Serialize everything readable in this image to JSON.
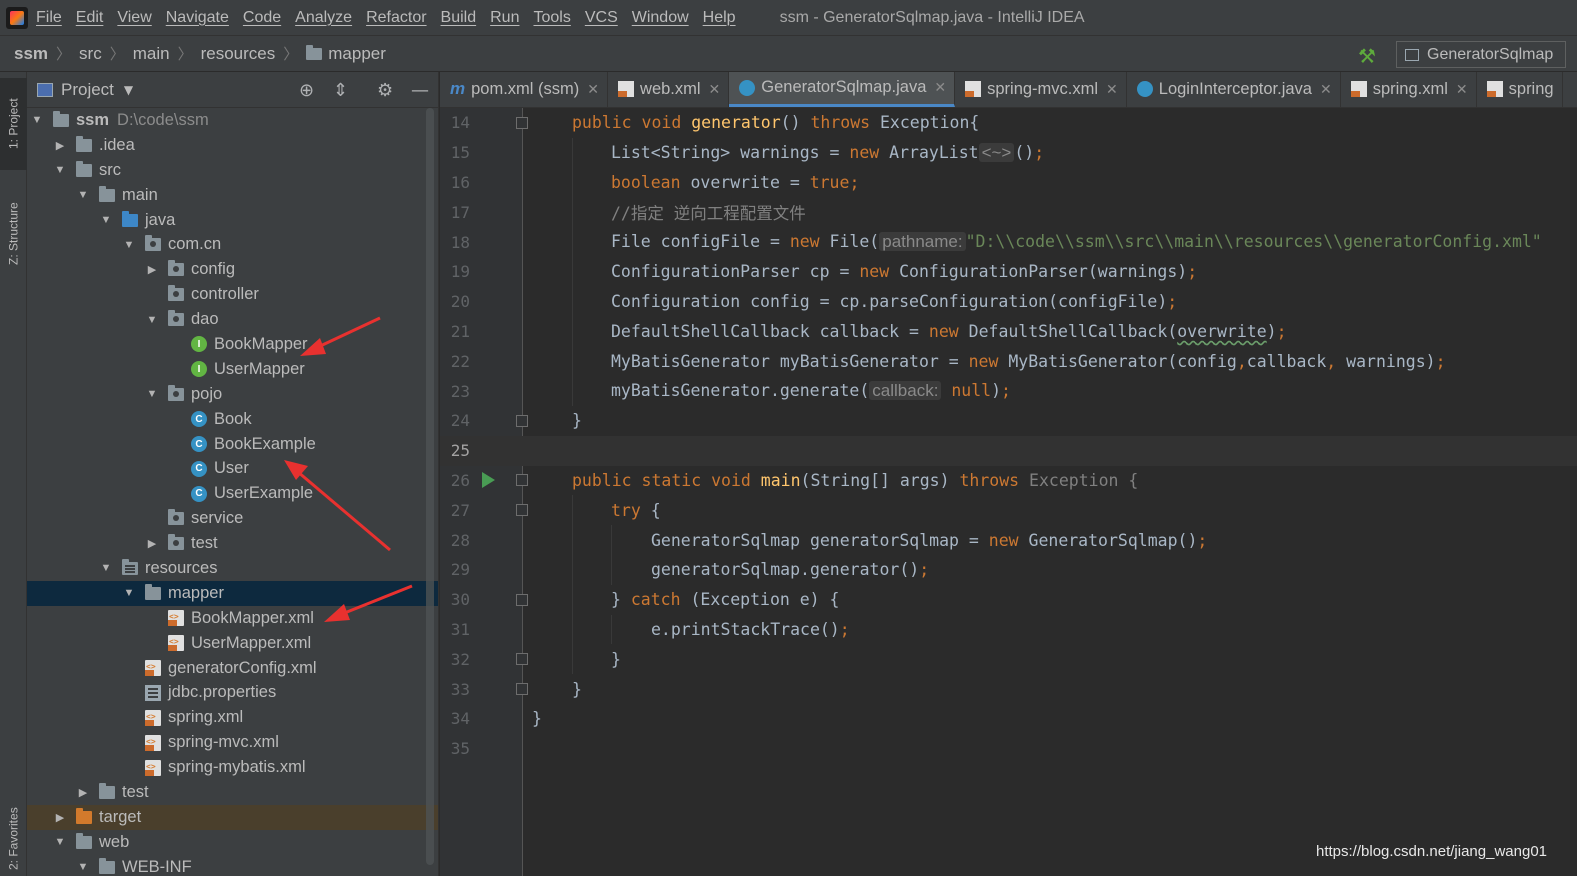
{
  "menubar": {
    "items": [
      "File",
      "Edit",
      "View",
      "Navigate",
      "Code",
      "Analyze",
      "Refactor",
      "Build",
      "Run",
      "Tools",
      "VCS",
      "Window",
      "Help"
    ],
    "window_title": "ssm - GeneratorSqlmap.java - IntelliJ IDEA"
  },
  "navbar": {
    "crumbs": [
      "ssm",
      "src",
      "main",
      "resources",
      "mapper"
    ],
    "run_config": "GeneratorSqlmap"
  },
  "toolstrip": {
    "project": "1: Project",
    "structure": "Z: Structure",
    "favorites": "2: Favorites"
  },
  "project_panel": {
    "title": "Project",
    "tree": [
      {
        "label": "ssm",
        "path": "D:\\code\\ssm"
      },
      {
        "label": ".idea"
      },
      {
        "label": "src"
      },
      {
        "label": "main"
      },
      {
        "label": "java"
      },
      {
        "label": "com.cn"
      },
      {
        "label": "config"
      },
      {
        "label": "controller"
      },
      {
        "label": "dao"
      },
      {
        "label": "BookMapper"
      },
      {
        "label": "UserMapper"
      },
      {
        "label": "pojo"
      },
      {
        "label": "Book"
      },
      {
        "label": "BookExample"
      },
      {
        "label": "User"
      },
      {
        "label": "UserExample"
      },
      {
        "label": "service"
      },
      {
        "label": "test"
      },
      {
        "label": "resources"
      },
      {
        "label": "mapper"
      },
      {
        "label": "BookMapper.xml"
      },
      {
        "label": "UserMapper.xml"
      },
      {
        "label": "generatorConfig.xml"
      },
      {
        "label": "jdbc.properties"
      },
      {
        "label": "spring.xml"
      },
      {
        "label": "spring-mvc.xml"
      },
      {
        "label": "spring-mybatis.xml"
      },
      {
        "label": "test"
      },
      {
        "label": "target"
      },
      {
        "label": "web"
      },
      {
        "label": "WEB-INF"
      }
    ]
  },
  "editor": {
    "tabs": [
      {
        "label": "pom.xml (ssm)"
      },
      {
        "label": "web.xml"
      },
      {
        "label": "GeneratorSqlmap.java"
      },
      {
        "label": "spring-mvc.xml"
      },
      {
        "label": "LoginInterceptor.java"
      },
      {
        "label": "spring.xml"
      },
      {
        "label": "spring"
      }
    ],
    "line_numbers": [
      "14",
      "15",
      "16",
      "17",
      "18",
      "19",
      "20",
      "21",
      "22",
      "23",
      "24",
      "25",
      "26",
      "27",
      "28",
      "29",
      "30",
      "31",
      "32",
      "33",
      "34",
      "35"
    ],
    "code": {
      "l14": [
        "public",
        " ",
        "void",
        " ",
        "generator",
        "()",
        " ",
        "throws",
        " Exception{"
      ],
      "l15": [
        "List<String> warnings = ",
        "new",
        " ArrayList",
        "<~>",
        "()",
        ";"
      ],
      "l16": [
        "boolean",
        " overwrite = ",
        "true",
        ";"
      ],
      "l17": [
        "//指定 逆向工程配置文件"
      ],
      "l18": [
        "File configFile = ",
        "new",
        " File(",
        "pathname:",
        "\"D:\\\\code\\\\ssm\\\\src\\\\main\\\\resources\\\\generatorConfig.xml\""
      ],
      "l19": [
        "ConfigurationParser cp = ",
        "new",
        " ConfigurationParser(warnings)",
        ";"
      ],
      "l20": [
        "Configuration config = cp.parseConfiguration(configFile)",
        ";"
      ],
      "l21": [
        "DefaultShellCallback callback = ",
        "new",
        " DefaultShellCallback(",
        "overwrite",
        ")",
        ";"
      ],
      "l22": [
        "MyBatisGenerator myBatisGenerator = ",
        "new",
        " MyBatisGenerator(config",
        ",",
        "callback",
        ",",
        " warnings)",
        ";"
      ],
      "l23": [
        "myBatisGenerator.generate(",
        "callback:",
        " ",
        "null",
        ")",
        ";"
      ],
      "l24": [
        "}"
      ],
      "l26": [
        "public",
        " ",
        "static",
        " ",
        "void",
        " ",
        "main",
        "(String[] args) ",
        "throws",
        " Exception {"
      ],
      "l27": [
        "try",
        " {"
      ],
      "l28": [
        "GeneratorSqlmap generatorSqlmap = ",
        "new",
        " GeneratorSqlmap()",
        ";"
      ],
      "l29": [
        "generatorSqlmap.generator()",
        ";"
      ],
      "l30": [
        "} ",
        "catch",
        " (Exception e) {"
      ],
      "l31": [
        "e.printStackTrace()",
        ";"
      ],
      "l32": [
        "}"
      ],
      "l33": [
        "}"
      ],
      "l34": [
        "}"
      ]
    }
  },
  "watermark": "https://blog.csdn.net/jiang_wang01",
  "colors": {
    "keyword": "#cc7832",
    "method": "#ffc66d",
    "comment": "#808080",
    "string": "#6a8759",
    "annotation_arrow": "#e8312f"
  }
}
